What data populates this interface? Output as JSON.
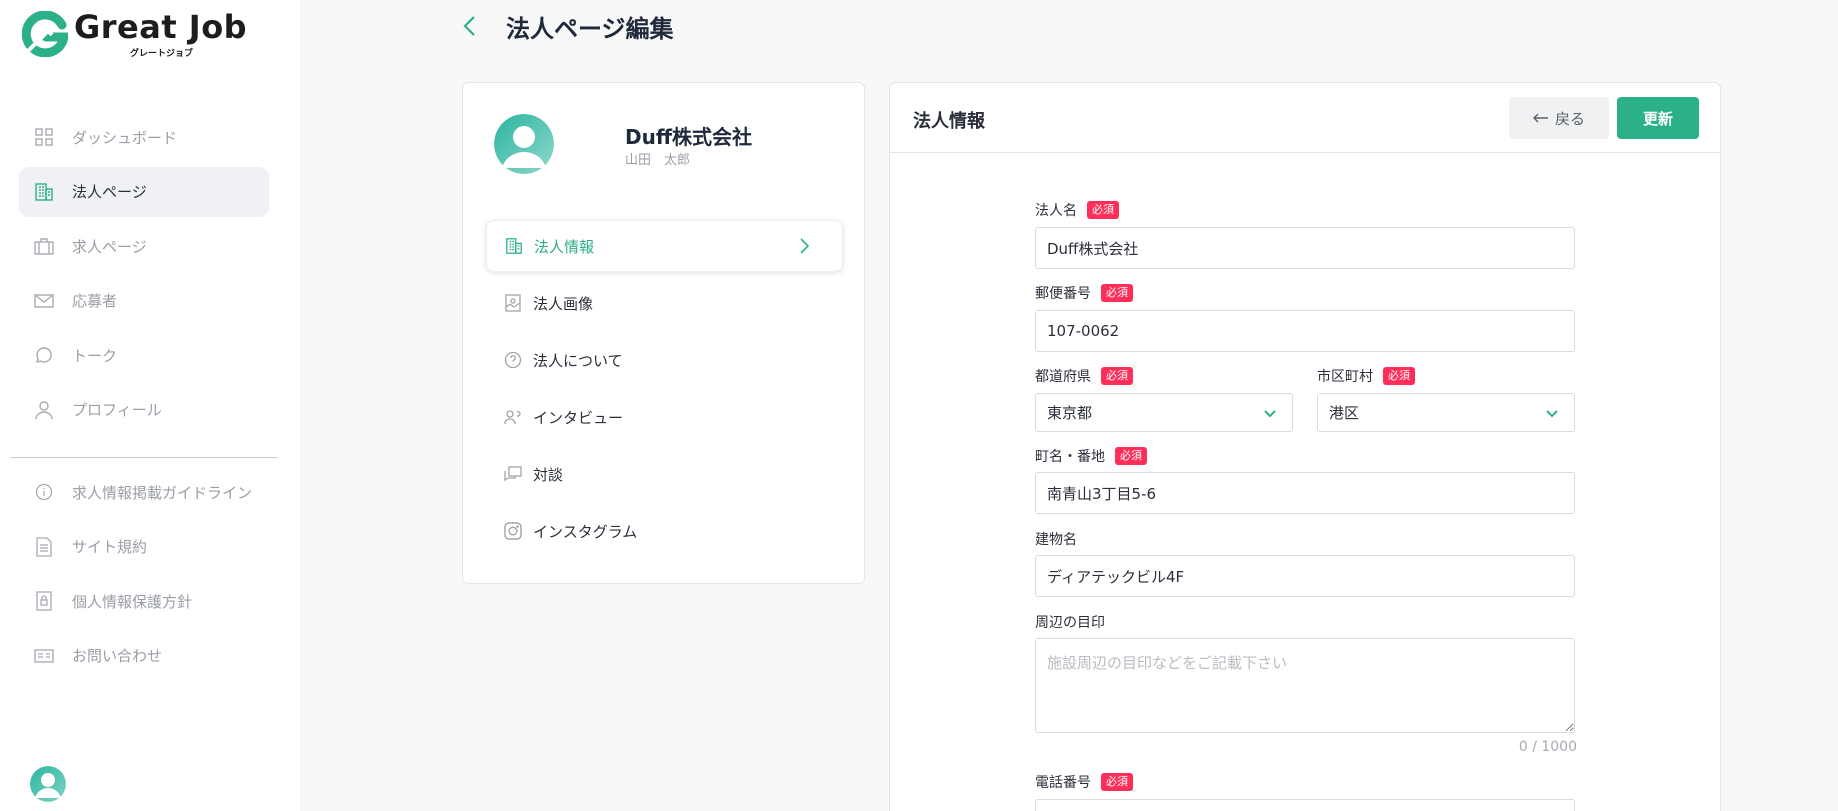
{
  "brand": {
    "name": "Great Job",
    "sub": "グレートジョブ"
  },
  "sidebar": {
    "items": [
      {
        "label": "ダッシュボード",
        "icon": "grid-icon",
        "active": false
      },
      {
        "label": "法人ページ",
        "icon": "building-icon",
        "active": true
      },
      {
        "label": "求人ページ",
        "icon": "briefcase-icon",
        "active": false
      },
      {
        "label": "応募者",
        "icon": "mail-icon",
        "active": false
      },
      {
        "label": "トーク",
        "icon": "chat-bubble-icon",
        "active": false
      },
      {
        "label": "プロフィール",
        "icon": "user-icon",
        "active": false
      }
    ],
    "secondary": [
      {
        "label": "求人情報掲載ガイドライン",
        "icon": "info-circle-icon"
      },
      {
        "label": "サイト規約",
        "icon": "document-icon"
      },
      {
        "label": "個人情報保護方針",
        "icon": "lock-document-icon"
      },
      {
        "label": "お問い合わせ",
        "icon": "contact-card-icon"
      }
    ]
  },
  "header": {
    "title": "法人ページ編集"
  },
  "company": {
    "name": "Duff株式会社",
    "user": "山田　太郎"
  },
  "menu": [
    {
      "label": "法人情報",
      "icon": "building-icon",
      "active": true
    },
    {
      "label": "法人画像",
      "icon": "image-icon",
      "active": false
    },
    {
      "label": "法人について",
      "icon": "question-circle-icon",
      "active": false
    },
    {
      "label": "インタビュー",
      "icon": "interview-icon",
      "active": false
    },
    {
      "label": "対談",
      "icon": "dialogue-icon",
      "active": false
    },
    {
      "label": "インスタグラム",
      "icon": "instagram-icon",
      "active": false
    }
  ],
  "panel": {
    "title": "法人情報",
    "back_label": "戻る",
    "update_label": "更新"
  },
  "form": {
    "required_badge": "必須",
    "company_name": {
      "label": "法人名",
      "value": "Duff株式会社"
    },
    "postal_code": {
      "label": "郵便番号",
      "value": "107-0062"
    },
    "prefecture": {
      "label": "都道府県",
      "value": "東京都"
    },
    "city": {
      "label": "市区町村",
      "value": "港区"
    },
    "street": {
      "label": "町名・番地",
      "value": "南青山3丁目5-6"
    },
    "building": {
      "label": "建物名",
      "value": "ディアテックビル4F"
    },
    "landmark": {
      "label": "周辺の目印",
      "placeholder": "施設周辺の目印などをご記載下さい",
      "counter": "0 / 1000"
    },
    "phone": {
      "label": "電話番号"
    }
  },
  "colors": {
    "accent": "#2bb08a",
    "required": "#ff2e58"
  }
}
